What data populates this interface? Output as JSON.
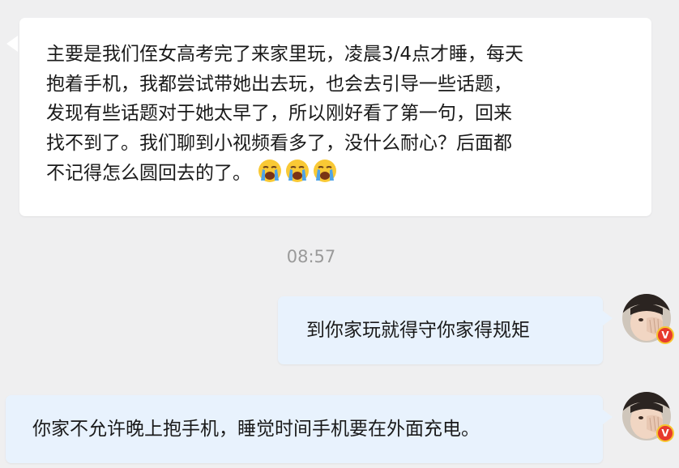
{
  "messages": [
    {
      "side": "left",
      "lines": [
        "主要是我们侄女高考完了来家里玩，凌晨3/4点才睡，每天",
        "抱着手机，我都尝试带她出去玩，也会去引导一些话题，",
        "发现有些话题对于她太早了，所以刚好看了第一句，回来",
        "找不到了。我们聊到小视频看多了，没什么耐心？后面都",
        "不记得怎么圆回去的了。"
      ],
      "emojis": [
        "crying-face-icon",
        "crying-face-icon",
        "crying-face-icon"
      ]
    },
    {
      "side": "right",
      "text": "到你家玩就得守你家得规矩"
    },
    {
      "side": "right",
      "text": "你家不允许晚上抱手机，睡觉时间手机要在外面充电。"
    }
  ],
  "timestamp": "08:57",
  "avatar": {
    "icon": "user-avatar",
    "badge_text": "V",
    "badge_color": "#e73a2d",
    "badge_ring": "#f7c52e"
  },
  "colors": {
    "background": "#efeff0",
    "incoming_bubble": "#ffffff",
    "outgoing_bubble": "#e8f2fd",
    "timestamp": "#9a9a9a"
  }
}
